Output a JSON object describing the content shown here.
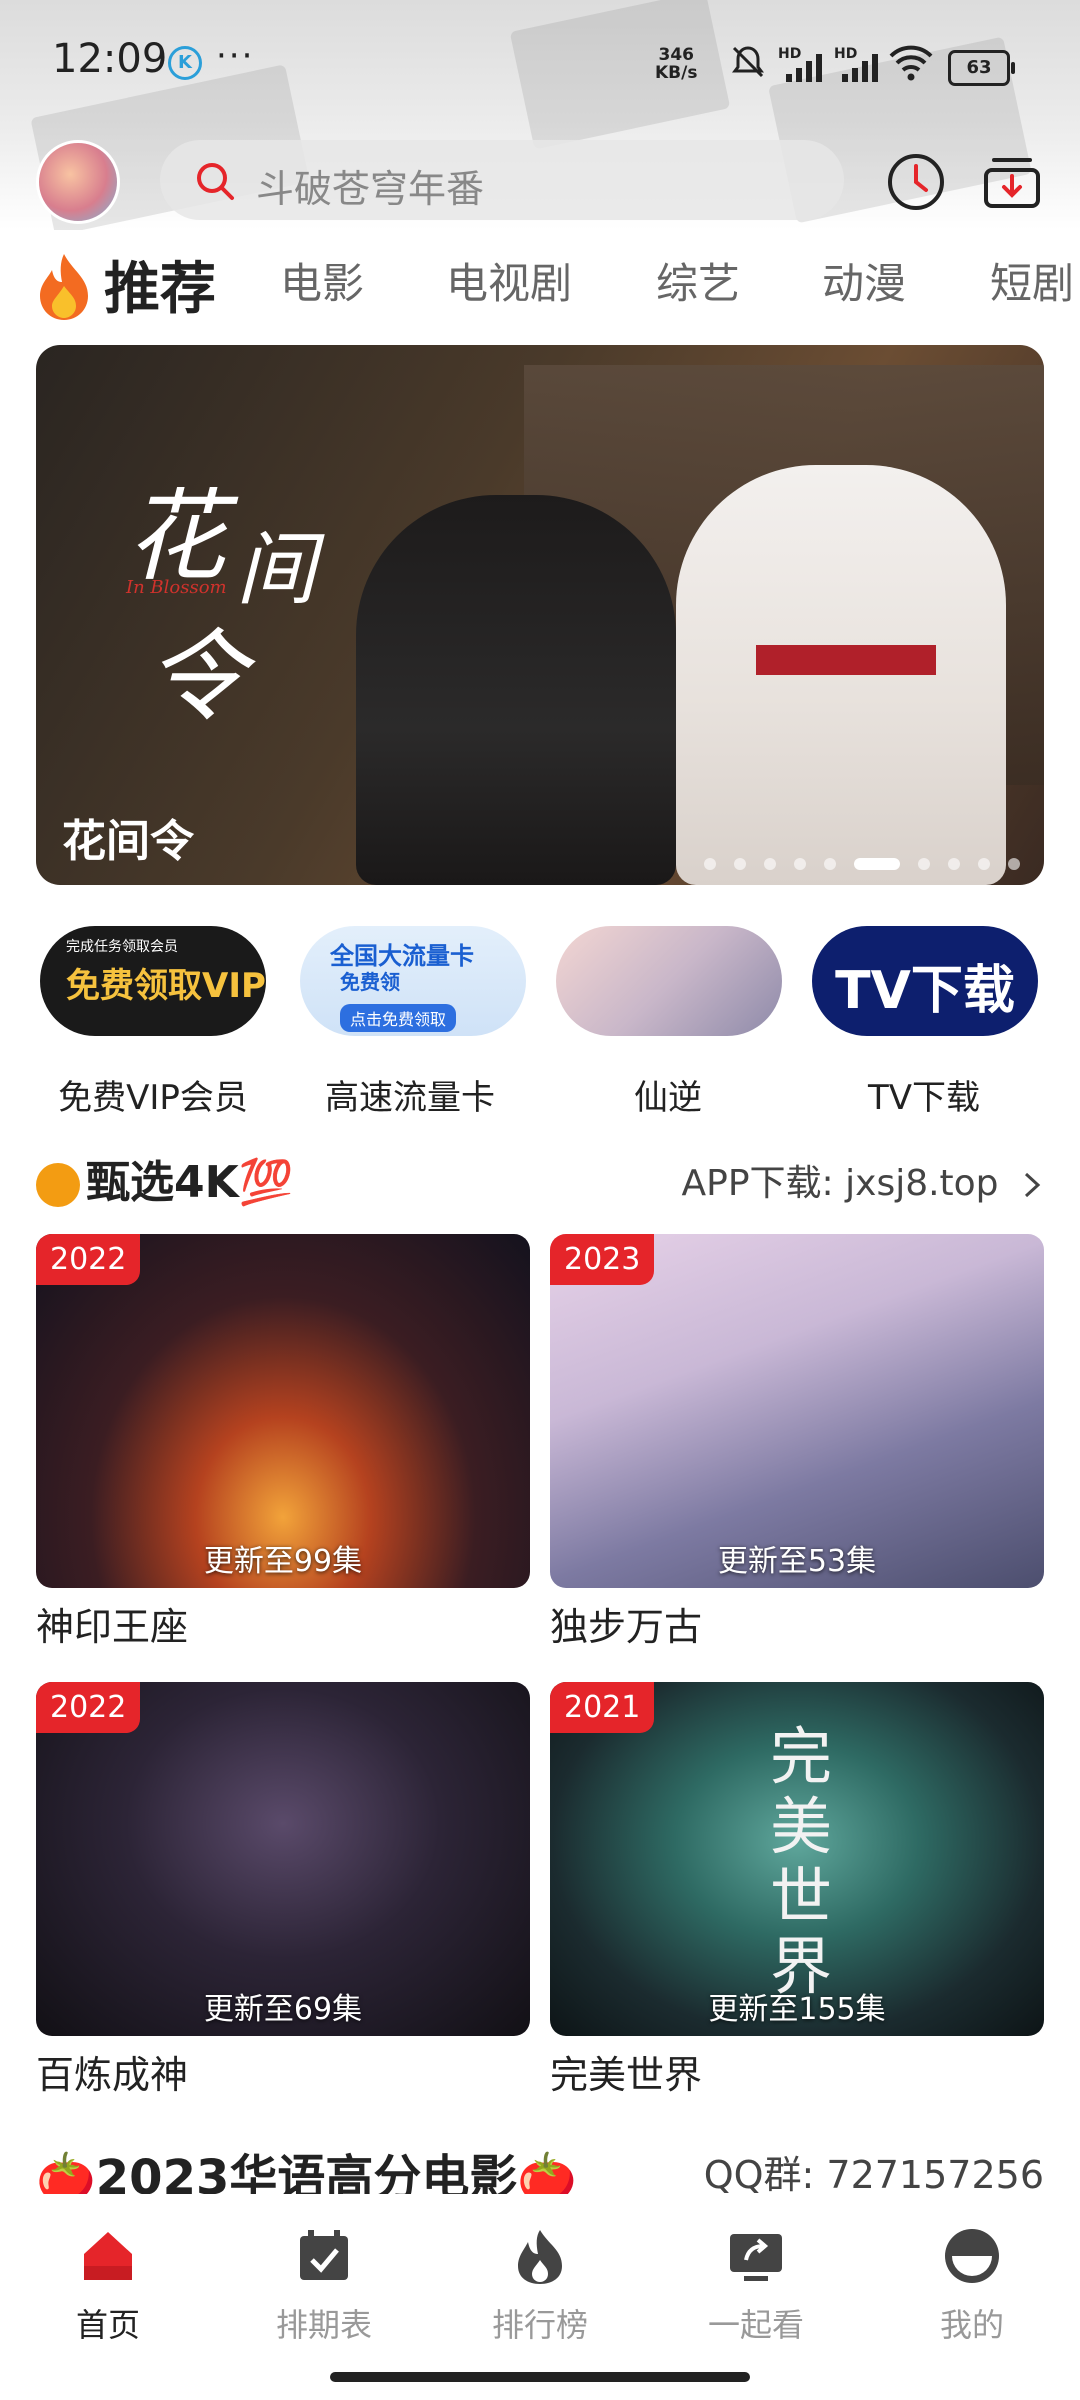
{
  "status_bar": {
    "time": "12:09",
    "k_icon": "K",
    "dots": "···",
    "net_speed_value": "346",
    "net_speed_unit": "KB/s",
    "hd_label_1": "HD",
    "hd_label_2": "HD",
    "battery": "63"
  },
  "header": {
    "search_placeholder": "斗破苍穹年番"
  },
  "tabs": [
    {
      "label": "推荐",
      "active": true
    },
    {
      "label": "电影"
    },
    {
      "label": "电视剧"
    },
    {
      "label": "综艺"
    },
    {
      "label": "动漫"
    },
    {
      "label": "短剧"
    }
  ],
  "banner": {
    "title": "花间令",
    "calligraphy": "花间令",
    "english": "In Blossom",
    "page_count": 10,
    "active_page": 6
  },
  "quick_entries": [
    {
      "label": "免费VIP会员",
      "card_text": "免费领取VIP",
      "card_sub": "完成任务领取会员"
    },
    {
      "label": "高速流量卡",
      "card_text": "全国大流量卡",
      "card_sub": "免费领",
      "card_btn": "点击免费领取"
    },
    {
      "label": "仙逆"
    },
    {
      "label": "TV下载",
      "card_text": "TV下载"
    }
  ],
  "section": {
    "title": "甄选4K💯",
    "right_text": "APP下载: jxsj8.top"
  },
  "cards": [
    {
      "year": "2022",
      "episode": "更新至99集",
      "title": "神印王座"
    },
    {
      "year": "2023",
      "episode": "更新至53集",
      "title": "独步万古"
    },
    {
      "year": "2022",
      "episode": "更新至69集",
      "title": "百炼成神"
    },
    {
      "year": "2021",
      "episode": "更新至155集",
      "title": "完美世界",
      "calligraphy": "完美世界"
    }
  ],
  "next_section": {
    "title": "🍅2023华语高分电影🍅",
    "right_text": "QQ群: 727157256"
  },
  "bottom_nav": [
    {
      "label": "首页",
      "active": true
    },
    {
      "label": "排期表"
    },
    {
      "label": "排行榜"
    },
    {
      "label": "一起看"
    },
    {
      "label": "我的"
    }
  ],
  "colors": {
    "accent": "#e5252a",
    "tv_blue": "#0d1f6e"
  }
}
